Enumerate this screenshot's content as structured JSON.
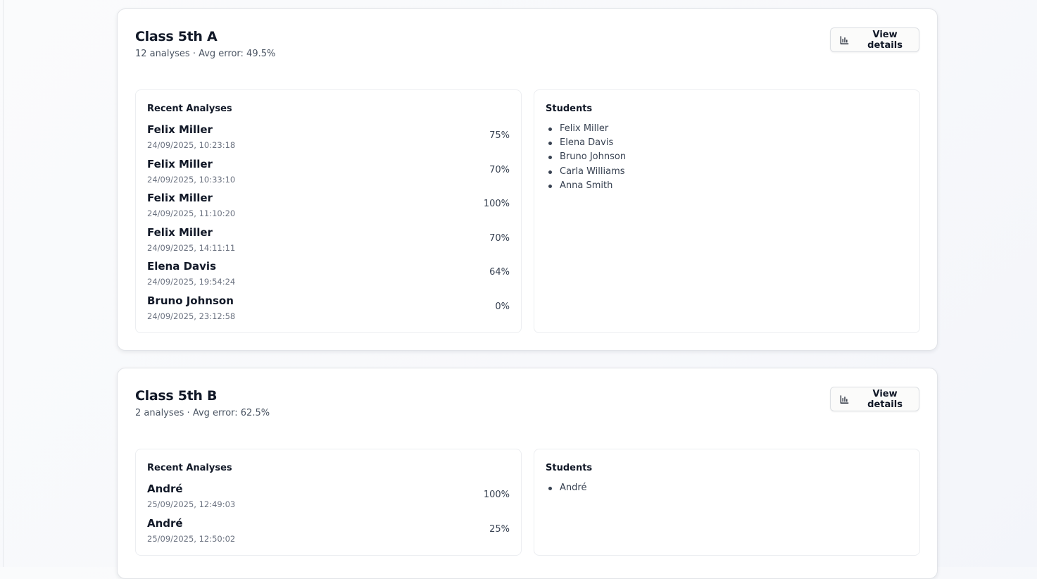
{
  "classes": [
    {
      "title": "Class 5th A",
      "subtitle": "12 analyses · Avg error: 49.5%",
      "button_label": "View details",
      "recent_title": "Recent Analyses",
      "students_title": "Students",
      "analyses": [
        {
          "name": "Felix Miller",
          "time": "24/09/2025, 10:23:18",
          "pct": "75%"
        },
        {
          "name": "Felix Miller",
          "time": "24/09/2025, 10:33:10",
          "pct": "70%"
        },
        {
          "name": "Felix Miller",
          "time": "24/09/2025, 11:10:20",
          "pct": "100%"
        },
        {
          "name": "Felix Miller",
          "time": "24/09/2025, 14:11:11",
          "pct": "70%"
        },
        {
          "name": "Elena Davis",
          "time": "24/09/2025, 19:54:24",
          "pct": "64%"
        },
        {
          "name": "Bruno Johnson",
          "time": "24/09/2025, 23:12:58",
          "pct": "0%"
        }
      ],
      "students": [
        "Felix Miller",
        "Elena Davis",
        "Bruno Johnson",
        "Carla Williams",
        "Anna Smith"
      ]
    },
    {
      "title": "Class 5th B",
      "subtitle": "2 analyses · Avg error: 62.5%",
      "button_label": "View details",
      "recent_title": "Recent Analyses",
      "students_title": "Students",
      "analyses": [
        {
          "name": "André",
          "time": "25/09/2025, 12:49:03",
          "pct": "100%"
        },
        {
          "name": "André",
          "time": "25/09/2025, 12:50:02",
          "pct": "25%"
        }
      ],
      "students": [
        "André"
      ]
    }
  ],
  "icons": {
    "view_details": "bar-chart-icon"
  }
}
